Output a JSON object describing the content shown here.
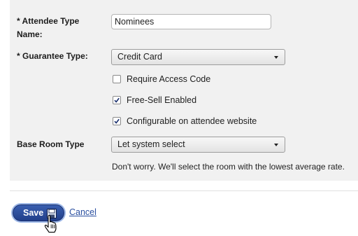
{
  "form": {
    "attendee_type": {
      "label_line1": "* Attendee Type",
      "label_line2": "Name:",
      "value": "Nominees"
    },
    "guarantee_type": {
      "label": "* Guarantee Type:",
      "selected": "Credit Card"
    },
    "checkboxes": [
      {
        "label": "Require Access Code",
        "checked": false
      },
      {
        "label": "Free-Sell Enabled",
        "checked": true
      },
      {
        "label": "Configurable on attendee website",
        "checked": true
      }
    ],
    "base_room_type": {
      "label": "Base Room Type",
      "selected": "Let system select",
      "hint": "Don't worry. We'll select the room with the lowest average rate."
    }
  },
  "actions": {
    "save_label": "Save",
    "cancel_label": "Cancel"
  },
  "icons": {
    "dropdown": "chevron-down-icon",
    "checkmark": "checkmark-icon",
    "save": "floppy-disk-icon",
    "cursor": "hand-pointer-icon"
  },
  "colors": {
    "panel_bg": "#f1f1f1",
    "save_button": "#2d4f9e",
    "link": "#2a4fa0"
  }
}
